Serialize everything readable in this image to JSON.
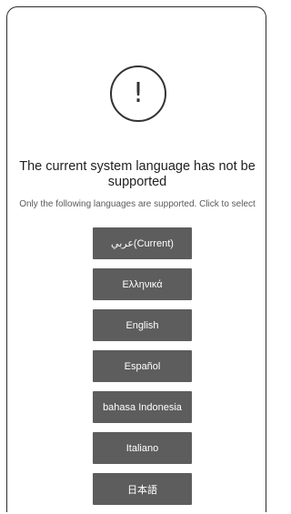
{
  "icon": "exclamation-circle-icon",
  "alert_glyph": "!",
  "title": "The current system language has not be supported",
  "subtitle": "Only the following languages are supported. Click to select",
  "languages": [
    {
      "label": "عربي(Current)"
    },
    {
      "label": "Ελληνικά"
    },
    {
      "label": "English"
    },
    {
      "label": "Español"
    },
    {
      "label": "bahasa Indonesia"
    },
    {
      "label": "Italiano"
    },
    {
      "label": "日本語"
    }
  ],
  "colors": {
    "button_bg": "#5d5d5d",
    "button_text": "#ffffff"
  }
}
